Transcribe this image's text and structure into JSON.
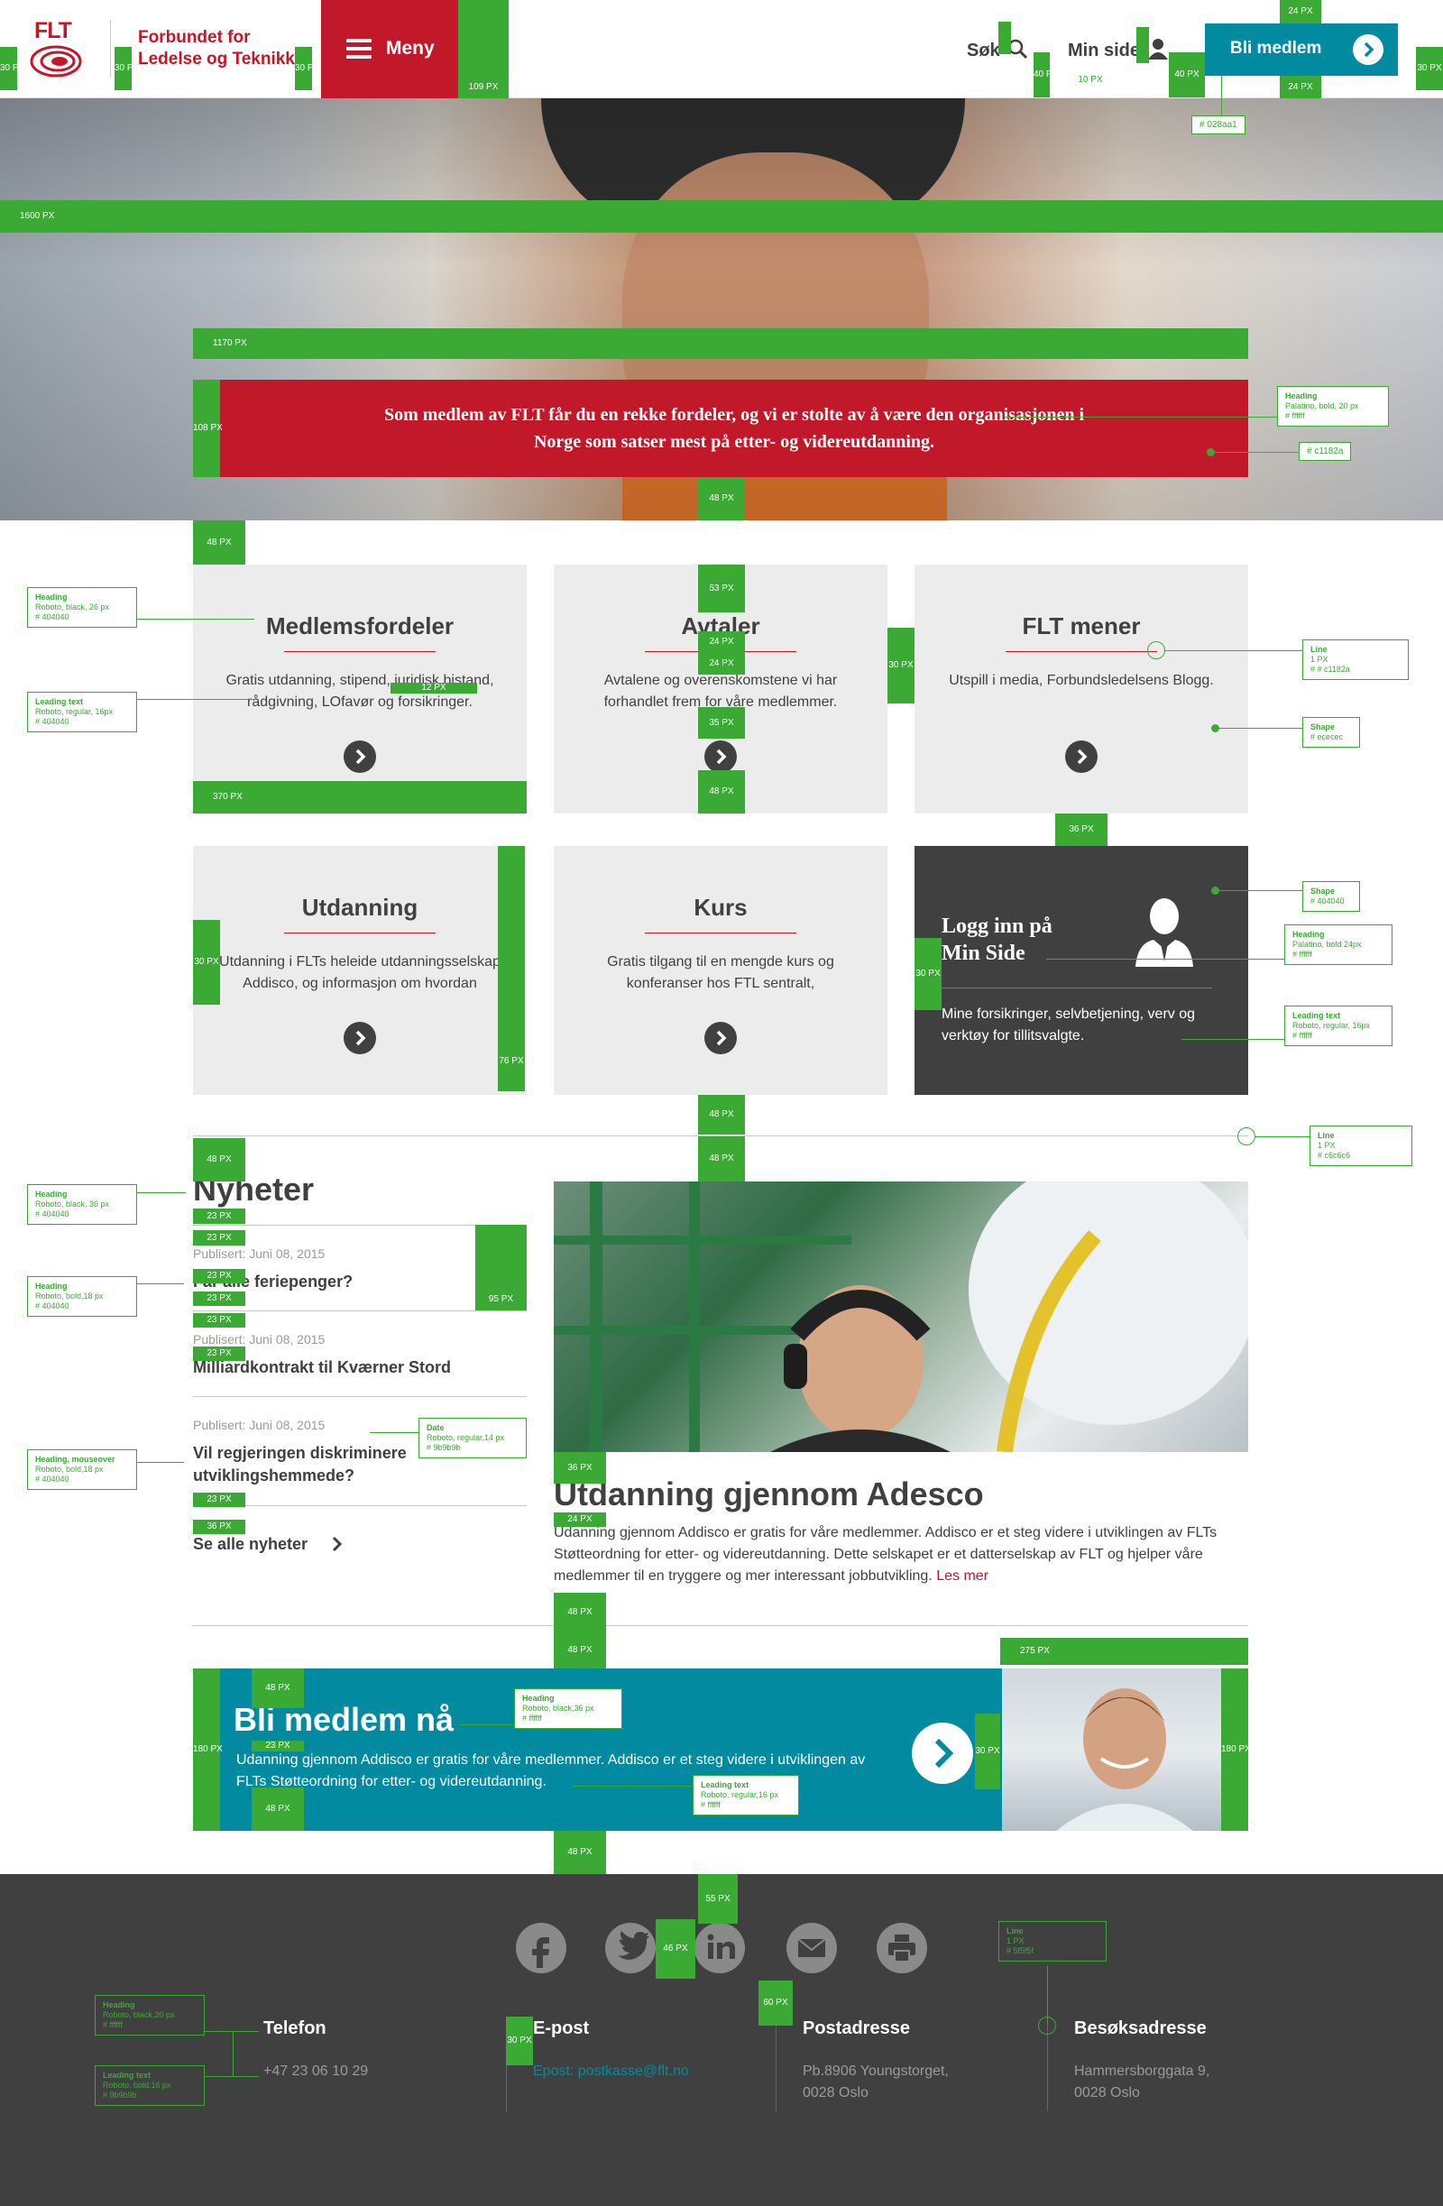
{
  "header": {
    "logo_text": "FLT",
    "brand_line1": "Forbundet for",
    "brand_line2": "Ledelse og Teknikk",
    "menu_label": "Meny",
    "search_label": "Søk",
    "minside_label": "Min side",
    "join_label": "Bli medlem"
  },
  "hero": {
    "banner_text": "Som medlem av FLT får du en rekke fordeler, og vi er stolte av å være den organisasjonen i Norge som satser mest på etter- og videreutdanning."
  },
  "cards": [
    {
      "title": "Medlemsfordeler",
      "text": "Gratis utdanning, stipend, juridisk bistand, rådgivning, LOfavør og forsikringer."
    },
    {
      "title": "Avtaler",
      "text": "Avtalene og overenskomstene vi har forhandlet frem for våre medlemmer."
    },
    {
      "title": "FLT mener",
      "text": "Utspill i media, Forbundsledelsens Blogg."
    },
    {
      "title": "Utdanning",
      "text": "Utdanning i FLTs heleide utdanningsselskap Addisco, og informasjon om hvordan"
    },
    {
      "title": "Kurs",
      "text": "Gratis tilgang til en mengde kurs og konferanser hos FTL sentralt,"
    },
    {
      "title_line1": "Logg inn på",
      "title_line2": "Min Side",
      "text": "Mine forsikringer, selvbetjening, verv og verktøy for tillitsvalgte."
    }
  ],
  "news": {
    "title": "Nyheter",
    "items": [
      {
        "date": "Publisert: Juni 08, 2015",
        "headline": "Får alle feriepenger?"
      },
      {
        "date": "Publisert: Juni 08, 2015",
        "headline": "Milliardkontrakt til Kværner Stord"
      },
      {
        "date": "Publisert: Juni 08, 2015",
        "headline": "Vil regjeringen diskriminere utviklingshemmede?"
      }
    ],
    "see_all": "Se alle nyheter"
  },
  "article": {
    "title": "Utdanning gjennom Adesco",
    "text": "Udanning gjennom Addisco er gratis for våre medlemmer. Addisco er et steg videre i utviklingen av FLTs Støtteordning for etter- og videreutdanning. Dette selskapet er et datterselskap av FLT og hjelper våre medlemmer til en tryggere og mer interessant jobbutvikling.",
    "more": "Les mer"
  },
  "join_banner": {
    "title": "Bli medlem nå",
    "text": "Udanning gjennom Addisco er gratis for våre medlemmer. Addisco er et steg videre i utviklingen av FLTs Støtteordning for etter- og videreutdanning."
  },
  "footer": {
    "social_icons": [
      "facebook-icon",
      "twitter-icon",
      "linkedin-icon",
      "mail-icon",
      "print-icon"
    ],
    "columns": [
      {
        "title": "Telefon",
        "line1": "+47 23 06 10 29",
        "line2": ""
      },
      {
        "title": "E-post",
        "line1": "Epost: postkasse@flt.no",
        "line2": ""
      },
      {
        "title": "Postadresse",
        "line1": "Pb.8906 Youngstorget,",
        "line2": "0028 Oslo"
      },
      {
        "title": "Besøksadresse",
        "line1": "Hammersborggata 9,",
        "line2": "0028 Oslo"
      }
    ]
  },
  "colors": {
    "brand_red": "#c1182a",
    "teal": "#028aa1",
    "text_dark": "#404040",
    "card_bg": "#ececec",
    "annotation_green": "#3aaa35"
  },
  "annotations": {
    "dims": {
      "px30": "30 PX",
      "px109": "109 PX",
      "px24": "24 PX",
      "px10": "10 PX",
      "px40": "40 PX",
      "px1600": "1600 PX",
      "px1170": "1170 PX",
      "px108": "108 PX",
      "px48": "48 PX",
      "px53": "53 PX",
      "px35": "35 PX",
      "px370": "370 PX",
      "px36": "36 PX",
      "px12": "12 PX",
      "px76": "76 PX",
      "px23": "23 PX",
      "px95": "95 PX",
      "px275": "275 PX",
      "px180": "180 PX",
      "px55": "55 PX",
      "px46": "46 PX",
      "px60": "60 PX"
    },
    "hex_teal": "# 028aa1",
    "hex_red": "# c1182a",
    "specs": {
      "hero_heading": {
        "title": "Heading",
        "l1": "Palatino, bold, 20 px",
        "l2": "# ffffff"
      },
      "card_heading": {
        "title": "Heading",
        "l1": "Roboto, black, 26 px",
        "l2": "# 404040"
      },
      "card_lead": {
        "title": "Leading text",
        "l1": "Roboto, regular, 16px",
        "l2": "# 404040"
      },
      "card_line": {
        "title": "Line",
        "l1": "1 PX",
        "l2": "# # c1182a"
      },
      "card_shape": {
        "title": "Shape",
        "l1": "# ececec",
        "l2": ""
      },
      "dark_shape": {
        "title": "Shape",
        "l1": "# 404040",
        "l2": ""
      },
      "dark_heading": {
        "title": "Heading",
        "l1": "Palatino, bold 24px",
        "l2": "# ffffff"
      },
      "dark_lead": {
        "title": "Leading text",
        "l1": "Roboto, regular, 16px",
        "l2": "# ffffff"
      },
      "section_line": {
        "title": "Line",
        "l1": "1 PX",
        "l2": "# c6c6c6"
      },
      "news_heading": {
        "title": "Heading",
        "l1": "Roboto, black, 36 px",
        "l2": "# 404040"
      },
      "news_item_heading": {
        "title": "Heading",
        "l1": "Roboto, bold,18 px",
        "l2": "# 404040"
      },
      "news_date": {
        "title": "Date",
        "l1": "Roboto, regular,14 px",
        "l2": "# 9b9b9b"
      },
      "news_mouseover": {
        "title": "Heading, mouseover",
        "l1": "Roboto, bold,18 px",
        "l2": "# 404040"
      },
      "join_heading": {
        "title": "Heading",
        "l1": "Roboto, black,36 px",
        "l2": "# ffffff"
      },
      "join_lead": {
        "title": "Leading text",
        "l1": "Roboto, regular,16 px",
        "l2": "# ffffff"
      },
      "footer_line": {
        "title": "Line",
        "l1": "1 PX",
        "l2": "# 5f5f5f"
      },
      "footer_heading": {
        "title": "Heading",
        "l1": "Roboto, black,20 px",
        "l2": "# ffffff"
      },
      "footer_lead": {
        "title": "Leading text",
        "l1": "Roboto, bold,16 px",
        "l2": "# 9b9b9b"
      }
    }
  }
}
